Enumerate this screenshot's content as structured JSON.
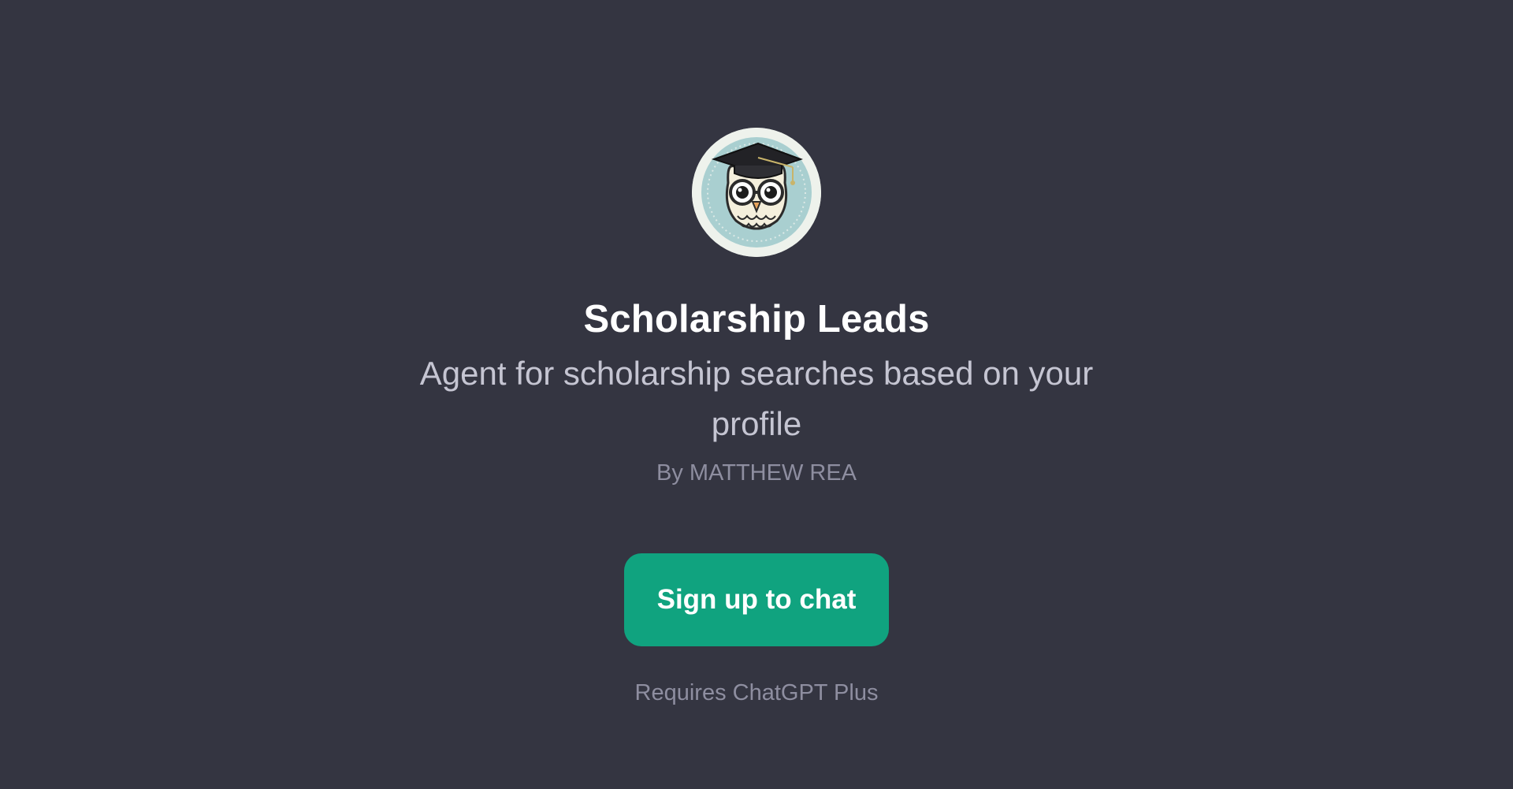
{
  "gpt": {
    "name": "Scholarship Leads",
    "description": "Agent for scholarship searches based on your profile",
    "author": "By MATTHEW REA",
    "avatar_icon": "owl-graduate-icon"
  },
  "cta": {
    "label": "Sign up to chat"
  },
  "footer": {
    "requirement": "Requires ChatGPT Plus"
  },
  "colors": {
    "background": "#343541",
    "title": "#ffffff",
    "subtitle": "#c5c5d2",
    "muted": "#8e8ea0",
    "accent": "#10a37f"
  }
}
